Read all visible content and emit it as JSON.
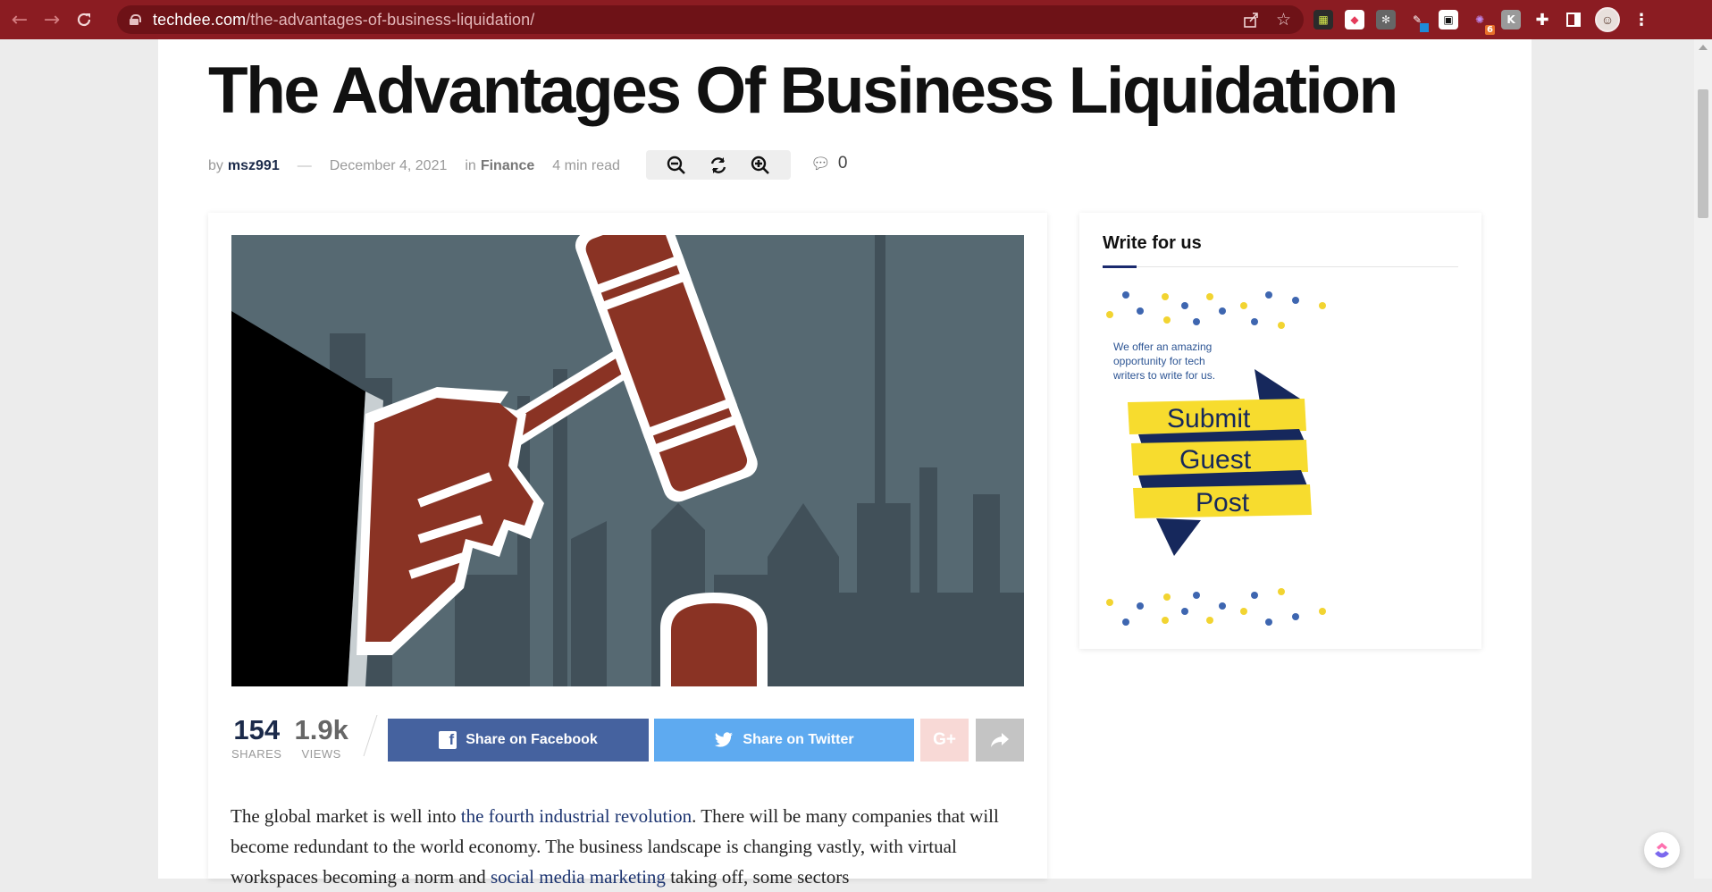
{
  "browser": {
    "url_host": "techdee.com",
    "url_path": "/the-advantages-of-business-liquidation/",
    "extension_badge": "6"
  },
  "article": {
    "title": "The Advantages Of Business Liquidation",
    "by_label": "by",
    "author": "msz991",
    "date": "December 4, 2021",
    "in_label": "in",
    "category": "Finance",
    "read_time": "4 min read",
    "comment_count": "0"
  },
  "stats": {
    "shares_value": "154",
    "shares_label": "SHARES",
    "views_value": "1.9k",
    "views_label": "VIEWS"
  },
  "share": {
    "facebook_label": "Share on Facebook",
    "twitter_label": "Share on Twitter"
  },
  "body": {
    "p1_a": "The global market is well into ",
    "p1_link1": "the fourth industrial revolution",
    "p1_b": ". There will be many companies that will become redundant to the world economy. The business landscape is changing vastly, with virtual workspaces becoming a norm and ",
    "p1_link2": "social media marketing",
    "p1_c": " taking off, some sectors"
  },
  "sidebar": {
    "widget_title": "Write for us",
    "promo_text_1": "We offer an amazing",
    "promo_text_2": "opportunity for tech",
    "promo_text_3": "writers to write for us.",
    "promo_banner_1": "Submit",
    "promo_banner_2": "Guest",
    "promo_banner_3": "Post"
  },
  "colors": {
    "browser_frame": "#8b1c22",
    "author_link": "#1b2a4a",
    "facebook": "#45629f",
    "twitter": "#5eaaf0",
    "google_plus": "#f8d9d6",
    "share_more": "#c4c4c4",
    "body_link": "#1c3470",
    "widget_accent": "#1b2a6e"
  },
  "icons": {
    "back": "arrow-left-icon",
    "forward": "arrow-right-icon",
    "reload": "reload-icon",
    "lock": "lock-icon",
    "share_page": "share-icon",
    "bookmark": "star-icon",
    "zoom_out": "zoom-out-icon",
    "reset": "refresh-icon",
    "zoom_in": "zoom-in-icon",
    "comment": "comment-icon",
    "facebook": "facebook-icon",
    "twitter": "twitter-icon",
    "google_plus": "google-plus-icon",
    "share_more": "share-arrow-icon"
  }
}
